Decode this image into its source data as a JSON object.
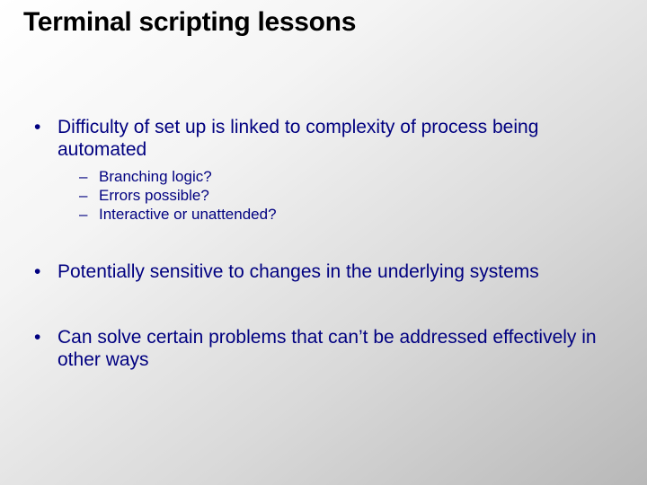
{
  "title": "Terminal scripting lessons",
  "bullets": {
    "p1": "Difficulty of set up is linked to complexity of process being automated",
    "p1subs": {
      "s1": "Branching logic?",
      "s2": "Errors possible?",
      "s3": "Interactive or unattended?"
    },
    "p2": "Potentially sensitive to changes in the underlying systems",
    "p3": "Can solve certain problems that can’t be addressed effectively in other ways"
  },
  "glyphs": {
    "bullet": "•",
    "dash": "–"
  }
}
